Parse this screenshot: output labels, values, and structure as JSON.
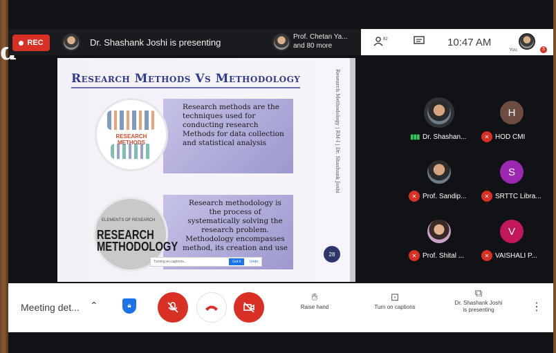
{
  "frame": {
    "left_letter": "d"
  },
  "topbar": {
    "rec_label": "REC",
    "presenting_text": "Dr. Shashank Joshi is presenting",
    "others_line1": "Prof. Chetan Ya...",
    "others_line2": "and 80 more",
    "time": "10:47 AM",
    "you_label": "You",
    "people_icon": "people-icon",
    "chat_icon": "chat-icon",
    "notification_count": "3"
  },
  "slide": {
    "title": "Research Methods Vs Methodology",
    "side_text": "Research Methodology | RM-I | Dr. Shashank Joshi",
    "circle1_label": "RESEARCH METHODS",
    "box1_text": "Research methods are the techniques used for conducting research Methods for data collection and statistical analysis",
    "circle2_small": "ELEMENTS OF RESEARCH",
    "circle2_text": "RESEARCH METHODOLOGY",
    "box2_text": "Research methodology is the process of systematically solving the research problem. Methodology encompasses method, its creation and use",
    "page_number": "28",
    "toast_text": "Turning on captions...",
    "toast_button": "Got it",
    "toast_link": "Undo"
  },
  "participants": [
    {
      "name": "Dr. Shashan...",
      "initial": "",
      "avatar": "photo",
      "status": "speaking"
    },
    {
      "name": "HOD CMI",
      "initial": "H",
      "avatar_color": "#6d4c41",
      "status": "muted"
    },
    {
      "name": "Prof. Sandip...",
      "initial": "",
      "avatar": "photo",
      "status": "muted"
    },
    {
      "name": "SRTTC Libra...",
      "initial": "S",
      "avatar_color": "#9c27b0",
      "status": "muted"
    },
    {
      "name": "Prof. Shital ...",
      "initial": "",
      "avatar": "photo-f",
      "status": "muted"
    },
    {
      "name": "VAISHALI P...",
      "initial": "V",
      "avatar_color": "#c2185b",
      "status": "muted"
    }
  ],
  "toolbar": {
    "meeting_details": "Meeting det...",
    "raise_hand": "Raise hand",
    "captions": "Turn on captions",
    "presenting_line1": "Dr. Shashank Joshi",
    "presenting_line2": "is presenting"
  }
}
